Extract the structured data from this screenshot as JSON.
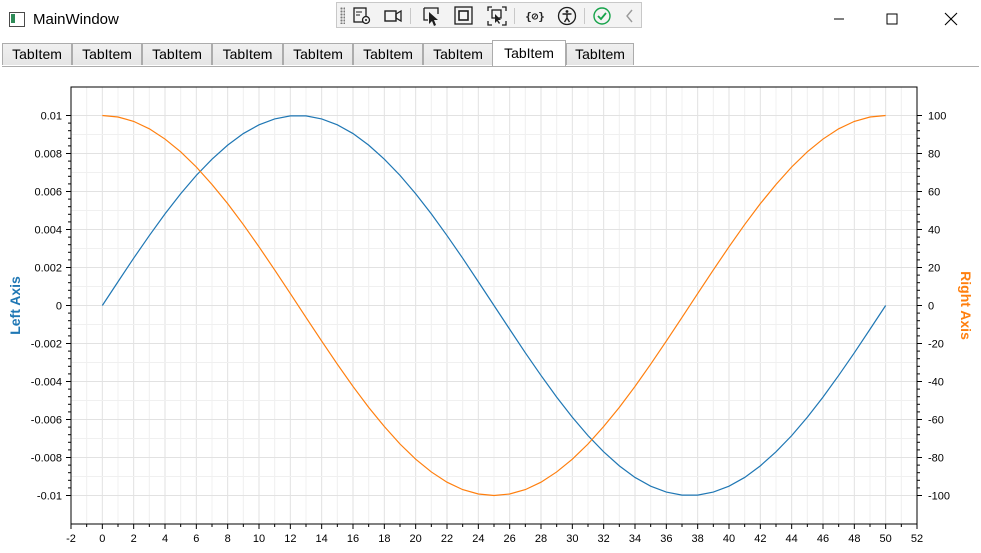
{
  "window": {
    "title": "MainWindow",
    "minimize_icon": "minimize-icon",
    "maximize_icon": "maximize-icon",
    "close_icon": "close-icon"
  },
  "debug_toolbar": {
    "icons": [
      "select-element-icon",
      "video-camera-icon",
      "pointer-select-icon",
      "display-layout-adorners-icon",
      "track-focus-icon",
      "binding-failures-icon",
      "accessibility-icon",
      "check-icon",
      "collapse-chevron-icon"
    ]
  },
  "tabs": [
    {
      "label": "TabItem",
      "selected": false
    },
    {
      "label": "TabItem",
      "selected": false
    },
    {
      "label": "TabItem",
      "selected": false
    },
    {
      "label": "TabItem",
      "selected": false
    },
    {
      "label": "TabItem",
      "selected": false
    },
    {
      "label": "TabItem",
      "selected": false
    },
    {
      "label": "TabItem",
      "selected": false
    },
    {
      "label": "TabItem",
      "selected": true
    },
    {
      "label": "TabItem",
      "selected": false
    }
  ],
  "chart_data": {
    "type": "line",
    "title": "",
    "xlabel": "",
    "ylabel": "Left Axis",
    "ylabel_right": "Right Axis",
    "xlim": [
      -2,
      52
    ],
    "ylim": [
      -0.0115,
      0.0115
    ],
    "ylim_right": [
      -115,
      115
    ],
    "x_ticks": [
      -2,
      0,
      2,
      4,
      6,
      8,
      10,
      12,
      14,
      16,
      18,
      20,
      22,
      24,
      26,
      28,
      30,
      32,
      34,
      36,
      38,
      40,
      42,
      44,
      46,
      48,
      50,
      52
    ],
    "x_tick_labels": [
      "-2",
      "0",
      "2",
      "4",
      "6",
      "8",
      "10",
      "12",
      "14",
      "16",
      "18",
      "20",
      "22",
      "24",
      "26",
      "28",
      "30",
      "32",
      "34",
      "36",
      "38",
      "40",
      "42",
      "44",
      "46",
      "48",
      "50",
      "52"
    ],
    "y_ticks": [
      0.01,
      0.008,
      0.006,
      0.004,
      0.002,
      0,
      -0.002,
      -0.004,
      -0.006,
      -0.008,
      -0.01
    ],
    "y_tick_labels": [
      "0.01",
      "0.008",
      "0.006",
      "0.004",
      "0.002",
      "0",
      "-0.002",
      "-0.004",
      "-0.006",
      "-0.008",
      "-0.01"
    ],
    "y_ticks_right": [
      100,
      80,
      60,
      40,
      20,
      0,
      -20,
      -40,
      -60,
      -80,
      -100
    ],
    "y_tick_labels_right": [
      "100",
      "80",
      "60",
      "40",
      "20",
      "0",
      "-20",
      "-40",
      "-60",
      "-80",
      "-100"
    ],
    "grid": true,
    "colors": {
      "left": "#1f77b4",
      "right": "#ff7f0e"
    },
    "series": [
      {
        "axis": "left",
        "color": "#1f77b4",
        "x": [
          0,
          1,
          2,
          3,
          4,
          5,
          6,
          7,
          8,
          9,
          10,
          11,
          12,
          13,
          14,
          15,
          16,
          17,
          18,
          19,
          20,
          21,
          22,
          23,
          24,
          25,
          26,
          27,
          28,
          29,
          30,
          31,
          32,
          33,
          34,
          35,
          36,
          37,
          38,
          39,
          40,
          41,
          42,
          43,
          44,
          45,
          46,
          47,
          48,
          49,
          50
        ],
        "y": [
          0,
          0.00125,
          0.00249,
          0.00368,
          0.00482,
          0.00588,
          0.00685,
          0.0077,
          0.00844,
          0.00905,
          0.00951,
          0.00982,
          0.00998,
          0.00998,
          0.00982,
          0.00951,
          0.00905,
          0.00844,
          0.0077,
          0.00685,
          0.00588,
          0.00482,
          0.00368,
          0.00249,
          0.00125,
          0,
          -0.00125,
          -0.00249,
          -0.00368,
          -0.00482,
          -0.00588,
          -0.00685,
          -0.0077,
          -0.00844,
          -0.00905,
          -0.00951,
          -0.00982,
          -0.00998,
          -0.00998,
          -0.00982,
          -0.00951,
          -0.00905,
          -0.00844,
          -0.0077,
          -0.00685,
          -0.00588,
          -0.00482,
          -0.00368,
          -0.00249,
          -0.00125,
          0
        ]
      },
      {
        "axis": "right",
        "color": "#ff7f0e",
        "x": [
          0,
          1,
          2,
          3,
          4,
          5,
          6,
          7,
          8,
          9,
          10,
          11,
          12,
          13,
          14,
          15,
          16,
          17,
          18,
          19,
          20,
          21,
          22,
          23,
          24,
          25,
          26,
          27,
          28,
          29,
          30,
          31,
          32,
          33,
          34,
          35,
          36,
          37,
          38,
          39,
          40,
          41,
          42,
          43,
          44,
          45,
          46,
          47,
          48,
          49,
          50
        ],
        "y": [
          100,
          99.2,
          96.9,
          93,
          87.6,
          80.9,
          72.9,
          63.7,
          53.6,
          42.6,
          30.9,
          18.7,
          6.3,
          -6.3,
          -18.7,
          -30.9,
          -42.6,
          -53.6,
          -63.7,
          -72.9,
          -80.9,
          -87.6,
          -93,
          -96.9,
          -99.2,
          -100,
          -99.2,
          -96.9,
          -93,
          -87.6,
          -80.9,
          -72.9,
          -63.7,
          -53.6,
          -42.6,
          -30.9,
          -18.7,
          -6.3,
          6.3,
          18.7,
          30.9,
          42.6,
          53.6,
          63.7,
          72.9,
          80.9,
          87.6,
          93,
          96.9,
          99.2,
          100
        ]
      }
    ]
  }
}
